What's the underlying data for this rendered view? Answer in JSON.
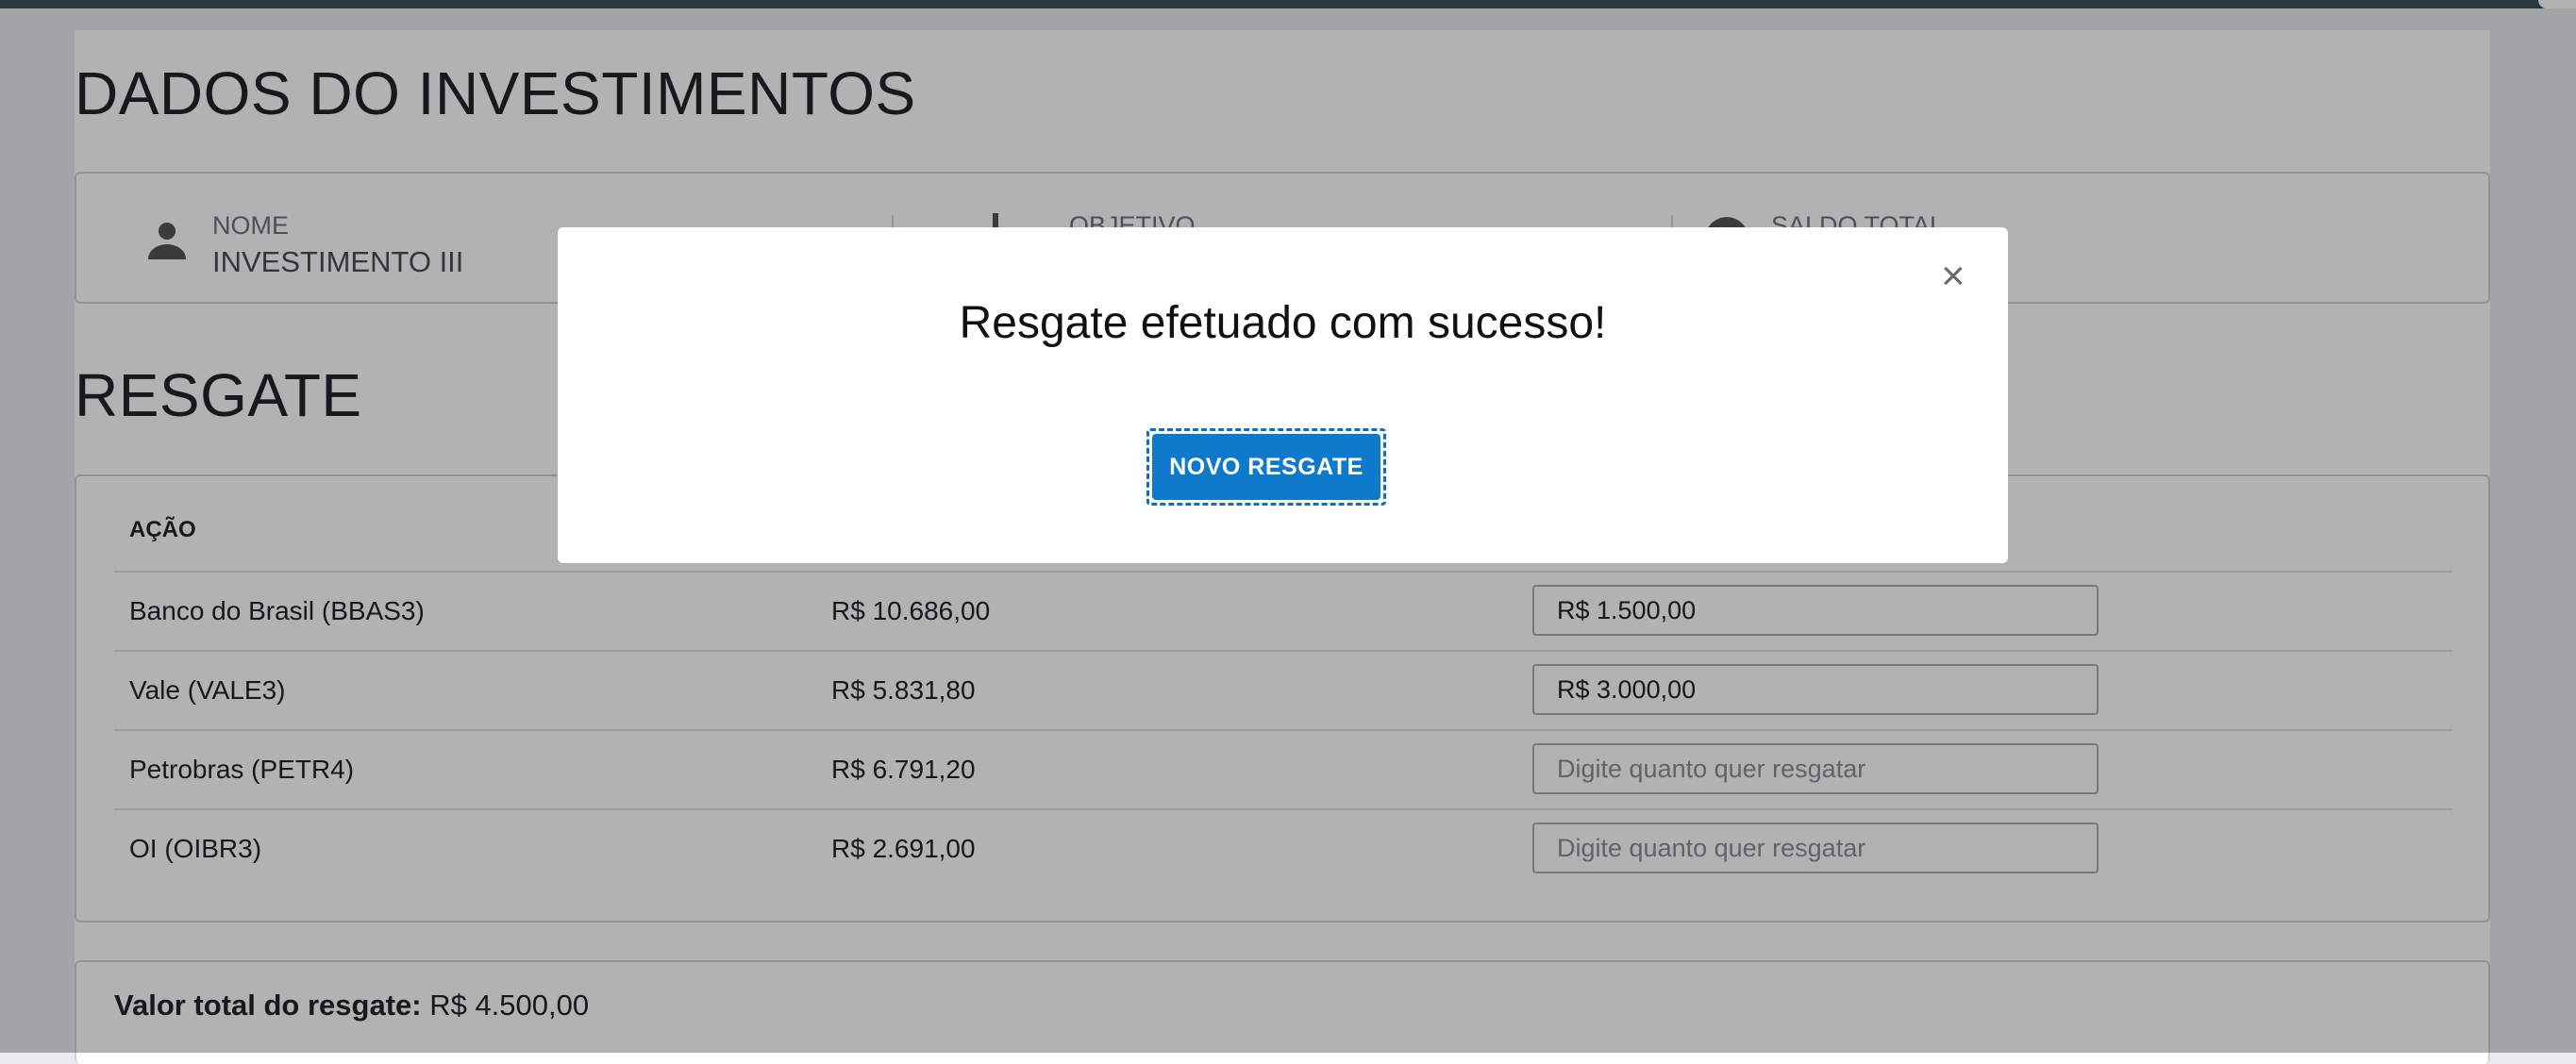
{
  "page": {
    "title": "DADOS DO INVESTIMENTOS",
    "info": [
      {
        "label": "NOME",
        "value": "INVESTIMENTO III",
        "icon": "person-icon"
      },
      {
        "label": "OBJETIVO",
        "value": "",
        "icon": "objective-icon"
      },
      {
        "label": "SALDO TOTAL",
        "value": "",
        "icon": "balance-icon"
      }
    ],
    "resgate_title": "RESGATE",
    "table": {
      "header": "AÇÃO",
      "rows": [
        {
          "acao": "Banco do Brasil (BBAS3)",
          "saldo": "R$ 10.686,00",
          "resgate": "R$ 1.500,00"
        },
        {
          "acao": "Vale (VALE3)",
          "saldo": "R$ 5.831,80",
          "resgate": "R$ 3.000,00"
        },
        {
          "acao": "Petrobras (PETR4)",
          "saldo": "R$ 6.791,20",
          "resgate": ""
        },
        {
          "acao": "OI (OIBR3)",
          "saldo": "R$ 2.691,00",
          "resgate": ""
        }
      ],
      "input_placeholder": "Digite quanto quer resgatar"
    },
    "total": {
      "label": "Valor total do resgate:",
      "value": "R$ 4.500,00"
    }
  },
  "modal": {
    "message": "Resgate efetuado com sucesso!",
    "close": "×",
    "button": "NOVO RESGATE"
  },
  "colors": {
    "primary": "#0f7acb",
    "topbar": "#404f58",
    "overlay": "rgba(0,0,0,0.30)"
  }
}
